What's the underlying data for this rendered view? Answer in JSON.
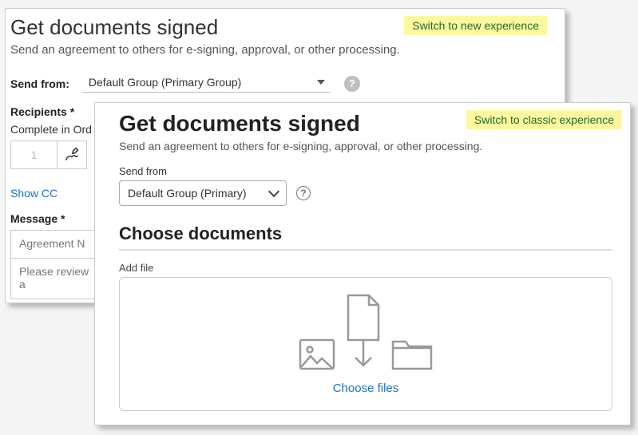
{
  "classic": {
    "switch_label": "Switch to new experience",
    "title": "Get documents signed",
    "subtitle": "Send an agreement to others for e-signing, approval, or other processing.",
    "send_from_label": "Send from:",
    "send_from_value": "Default Group (Primary Group)",
    "recipients_label": "Recipients *",
    "complete_in_order_label": "Complete in Ord",
    "recipient_number": "1",
    "show_cc": "Show CC",
    "message_label": "Message *",
    "agreement_name_placeholder": "Agreement N",
    "message_placeholder": "Please review a"
  },
  "modern": {
    "switch_label": "Switch to classic experience",
    "title": "Get documents signed",
    "subtitle": "Send an agreement to others for e-signing, approval, or other processing.",
    "send_from_label": "Send from",
    "send_from_value": "Default Group (Primary)",
    "choose_documents_title": "Choose documents",
    "add_file_label": "Add file",
    "choose_files_label": "Choose files"
  }
}
